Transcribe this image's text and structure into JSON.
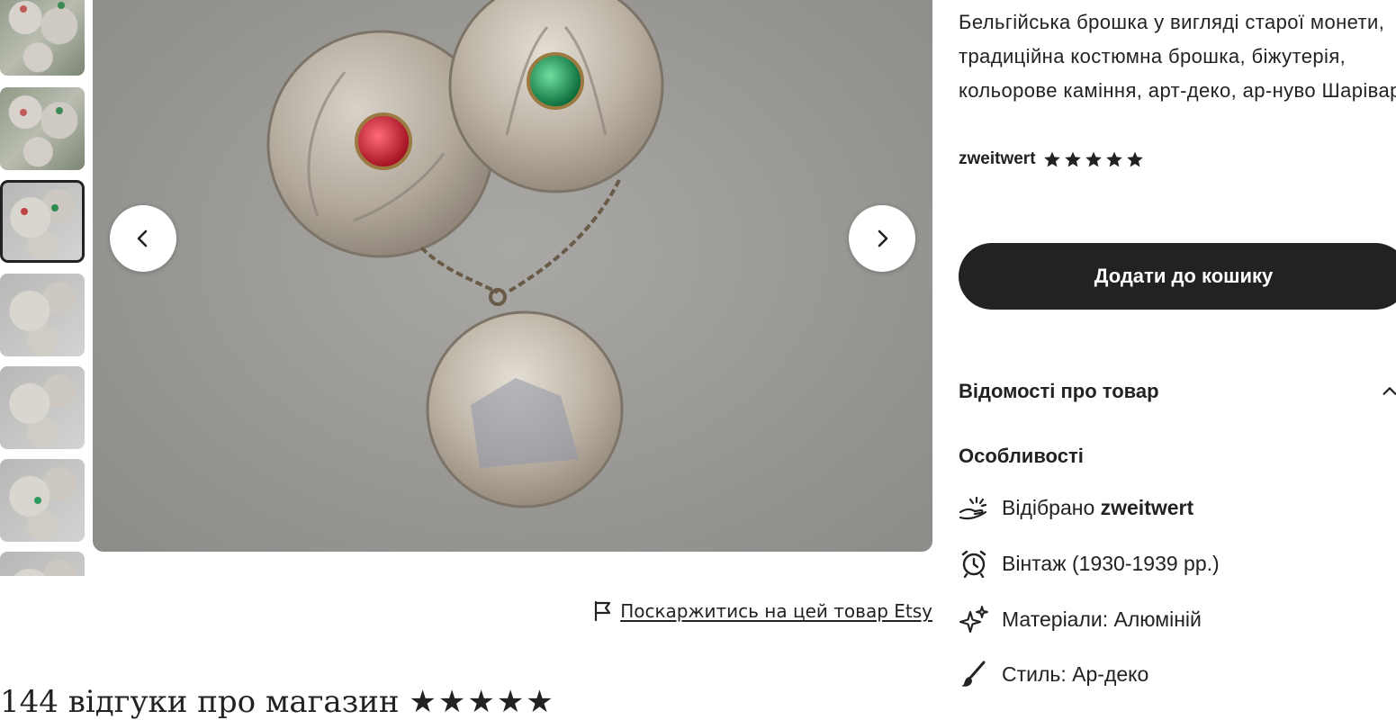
{
  "listing": {
    "title": "Бельгійська брошка у вигляді старої монети, традиційна костюмна брошка, біжутерія, кольорове каміння, арт-деко, ар-нуво Шаріварі",
    "seller_name": "zweitwert",
    "seller_rating_stars": 5,
    "add_to_cart_label": "Додати до кошику",
    "details_heading": "Відомості про товар",
    "highlights_heading": "Особливості",
    "features": [
      {
        "icon": "hand-heart-icon",
        "prefix": "Відібрано",
        "bold": "zweitwert"
      },
      {
        "icon": "alarm-clock-icon",
        "prefix": "Вінтаж (1930-1939 рр.)",
        "bold": ""
      },
      {
        "icon": "sparkle-icon",
        "prefix": "Матеріали: Алюміній",
        "bold": ""
      },
      {
        "icon": "paintbrush-icon",
        "prefix": "Стиль: Ар-деко",
        "bold": ""
      }
    ]
  },
  "gallery": {
    "thumbnail_count": 7,
    "active_index": 2,
    "prev_icon": "chevron-left-icon",
    "next_icon": "chevron-right-icon"
  },
  "report": {
    "icon": "flag-icon",
    "label": "Поскаржитись на цей товар Etsy"
  },
  "shop_reviews": {
    "label": "144 відгуки про магазин",
    "stars": 5
  },
  "colors": {
    "primary_button": "#222222",
    "text": "#222222",
    "background": "#ffffff"
  }
}
